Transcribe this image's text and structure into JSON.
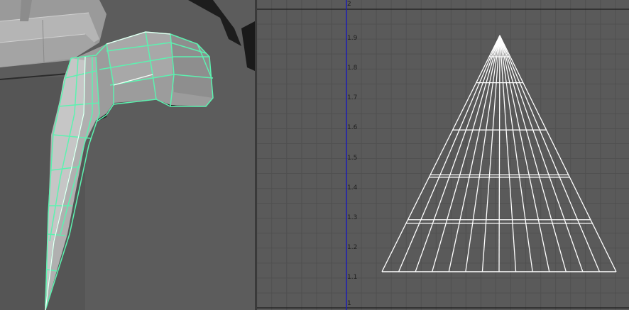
{
  "perspective_viewport": {
    "description_icon": "mesh-3d-view"
  },
  "uv_editor": {
    "v_axis_labels": [
      "2",
      "1.9",
      "1.8",
      "1.7",
      "1.6",
      "1.5",
      "1.4",
      "1.3",
      "1.2",
      "1.1",
      "1"
    ],
    "colors": {
      "background": "#5a5a5a",
      "grid": "#4f4f4f",
      "axis": "#1c1cb4",
      "uv_shell": "#ffffff"
    }
  },
  "viewport_colors": {
    "selection_wire": "#5cf2b0",
    "mesh": "#a8a8a8"
  }
}
